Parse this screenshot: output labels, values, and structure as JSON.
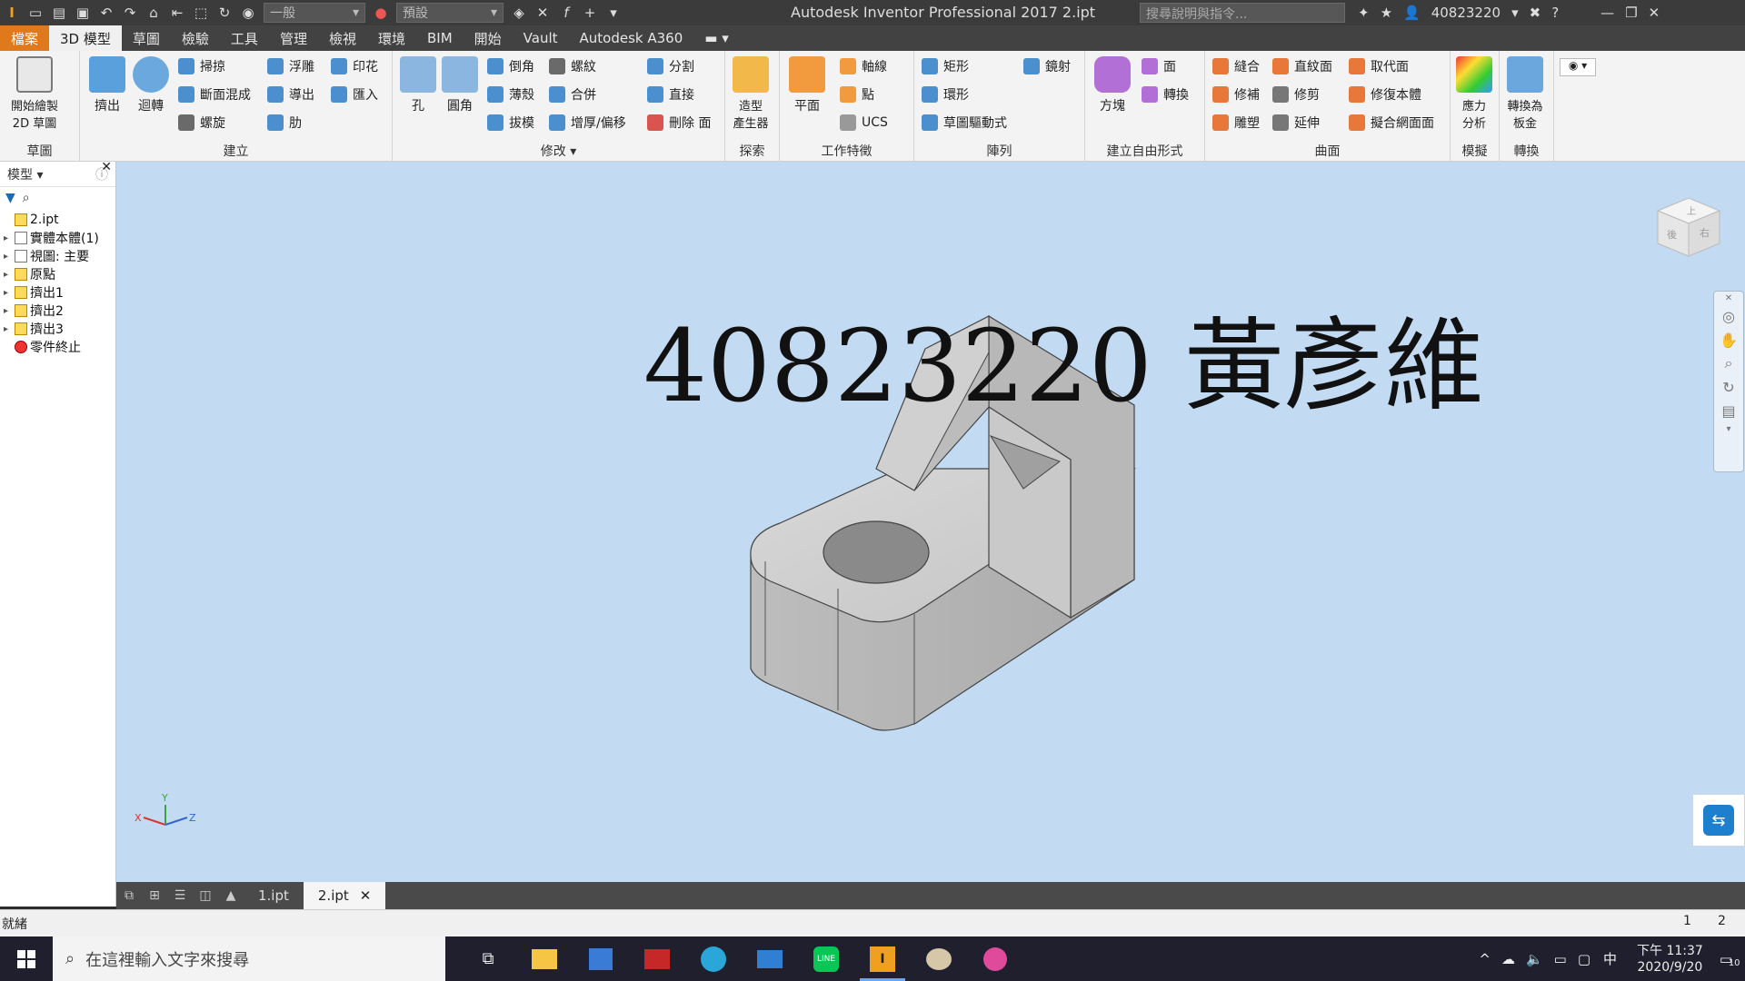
{
  "titlebar": {
    "title": "Autodesk Inventor Professional 2017    2.ipt",
    "style_select": "一般",
    "material_select": "預設",
    "search_placeholder": "搜尋說明與指令...",
    "user": "40823220"
  },
  "menubar": {
    "items": [
      "檔案",
      "3D 模型",
      "草圖",
      "檢驗",
      "工具",
      "管理",
      "檢視",
      "環境",
      "BIM",
      "開始",
      "Vault",
      "Autodesk A360"
    ]
  },
  "ribbon": {
    "sketch": {
      "start_sketch": "開始繪製\n2D 草圖",
      "group": "草圖"
    },
    "create": {
      "extrude": "擠出",
      "revolve": "迴轉",
      "sweep": "掃掠",
      "loft": "斷面混成",
      "coil": "螺旋",
      "emboss": "浮雕",
      "derive": "導出",
      "rib": "肋",
      "decal": "印花",
      "import": "匯入",
      "group": "建立"
    },
    "modify": {
      "hole": "孔",
      "fillet": "圓角",
      "chamfer": "倒角",
      "shell": "薄殼",
      "draft": "拔模",
      "thread": "螺紋",
      "combine": "合併",
      "thicken": "增厚/偏移",
      "split": "分割",
      "direct": "直接",
      "delete_face": "刪除 面",
      "group": "修改"
    },
    "explore": {
      "shape_generator": "造型\n產生器",
      "group": "探索"
    },
    "work": {
      "plane": "平面",
      "axis": "軸線",
      "point": "點",
      "ucs": "UCS",
      "group": "工作特徵"
    },
    "pattern": {
      "rect": "矩形",
      "circ": "環形",
      "sketch_driven": "草圖驅動式",
      "mirror": "鏡射",
      "group": "陣列"
    },
    "freeform": {
      "box": "方塊",
      "face": "面",
      "convert": "轉換",
      "group": "建立自由形式"
    },
    "surface": {
      "stitch": "縫合",
      "patch": "修補",
      "sculpt": "雕塑",
      "ruled": "直紋面",
      "trim": "修剪",
      "extend": "延伸",
      "replace": "取代面",
      "repair": "修復本體",
      "fit_mesh": "擬合網面面",
      "group": "曲面"
    },
    "simulation": {
      "stress": "應力\n分析",
      "group": "模擬"
    },
    "convert": {
      "sheet_metal": "轉換為\n板金",
      "group": "轉換"
    }
  },
  "browser": {
    "title": "模型",
    "items": [
      {
        "label": "2.ipt",
        "indent": 0
      },
      {
        "label": "實體本體(1)",
        "indent": 1
      },
      {
        "label": "視圖: 主要",
        "indent": 1
      },
      {
        "label": "原點",
        "indent": 1
      },
      {
        "label": "擠出1",
        "indent": 1
      },
      {
        "label": "擠出2",
        "indent": 1
      },
      {
        "label": "擠出3",
        "indent": 1
      },
      {
        "label": "零件終止",
        "indent": 1
      }
    ]
  },
  "viewport": {
    "annotation": "40823220 黃彥維",
    "viewcube_top": "上",
    "viewcube_left": "後",
    "viewcube_right": "右",
    "axis_x": "X",
    "axis_y": "Y",
    "axis_z": "Z"
  },
  "doctabs": [
    "1.ipt",
    "2.ipt"
  ],
  "status": {
    "text": "就緒",
    "n1": "1",
    "n2": "2"
  },
  "taskbar": {
    "search_placeholder": "在這裡輸入文字來搜尋",
    "ime": "中",
    "time": "下午 11:37",
    "date": "2020/9/20",
    "notif": "10"
  },
  "colors": {
    "accent": "#e0781c",
    "viewport_bg": "#c2dbf2",
    "ribbon_bg": "#f3f3f3"
  }
}
